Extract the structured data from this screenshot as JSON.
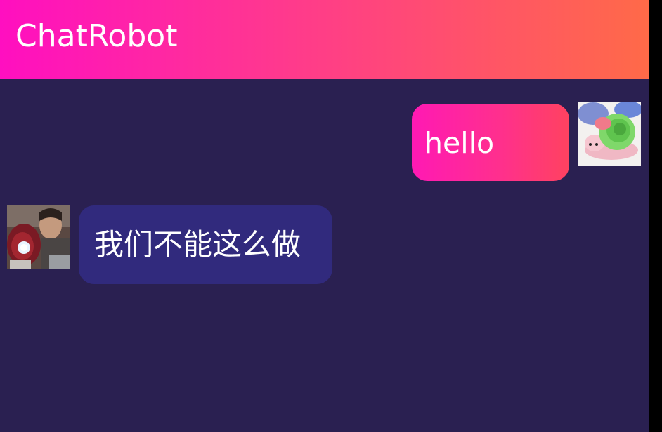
{
  "app_bar": {
    "title": "ChatRobot",
    "gradient": [
      "#ff0fc0",
      "#ff6a48"
    ]
  },
  "messages": [
    {
      "sender": "user",
      "text": "hello",
      "avatar_icon": "snail-toy-avatar",
      "bubble_gradient": [
        "#ff19b4",
        "#ff4260"
      ]
    },
    {
      "sender": "robot",
      "text": "我们不能这么做",
      "avatar_icon": "iron-man-avatar",
      "bubble_color": "#312a7d"
    }
  ],
  "colors": {
    "background": "#2a2051",
    "text": "#ffffff"
  }
}
